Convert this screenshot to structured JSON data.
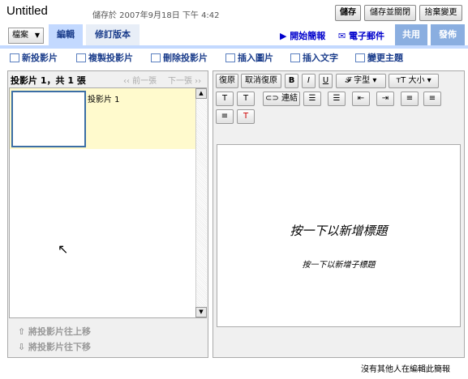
{
  "header": {
    "title": "Untitled",
    "saved_text": "儲存於 2007年9月18日 下午 4:42",
    "save_label": "儲存",
    "save_close_label": "儲存並關閉",
    "discard_label": "捨棄變更"
  },
  "menubar": {
    "file_menu": "檔案",
    "tabs": [
      "編輯",
      "修訂版本"
    ],
    "present_label": "開始簡報",
    "email_label": "電子郵件",
    "share_label": "共用",
    "publish_label": "發佈"
  },
  "toolbar": {
    "new_slide": "新投影片",
    "copy_slide": "複製投影片",
    "delete_slide": "刪除投影片",
    "insert_image": "插入圖片",
    "insert_text": "插入文字",
    "change_theme": "變更主題"
  },
  "slides_panel": {
    "header": "投影片 1，共 1 張",
    "prev": "‹‹ 前一張",
    "next": "下一張 ››",
    "slides": [
      {
        "label": "投影片 1"
      }
    ],
    "move_up": "將投影片往上移",
    "move_down": "將投影片往下移"
  },
  "format_toolbar": {
    "redo": "復原",
    "undo": "取消復原",
    "bold": "B",
    "italic": "I",
    "underline": "U",
    "font": "字型",
    "size": "大小",
    "link": "連結"
  },
  "editor": {
    "title_placeholder": "按一下以新增標題",
    "subtitle_placeholder": "按一下以新增子標題"
  },
  "status": "沒有其他人在編輯此簡報"
}
